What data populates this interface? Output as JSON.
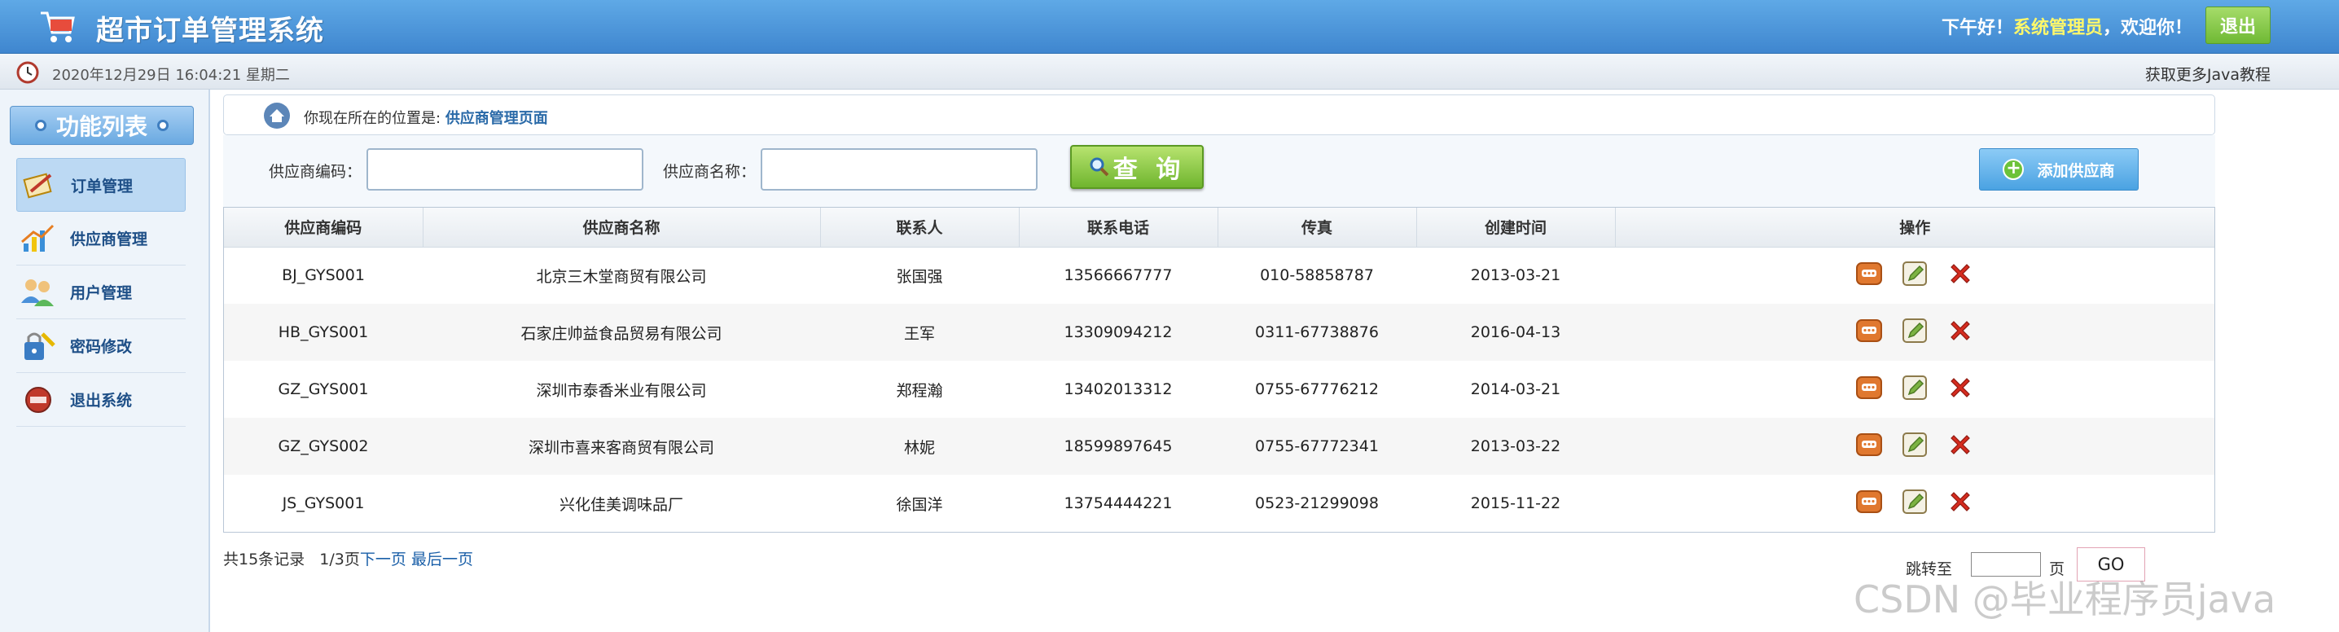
{
  "header": {
    "app_title": "超市订单管理系统",
    "greeting_prefix": "下午好！",
    "admin_name": "系统管理员",
    "greeting_suffix": "，欢迎你！",
    "logout_label": "退出"
  },
  "subbar": {
    "datetime": "2020年12月29日 16:04:21 星期二",
    "more_link": "获取更多Java教程"
  },
  "sidebar": {
    "title": "功能列表",
    "items": [
      {
        "label": "订单管理",
        "icon": "order-icon"
      },
      {
        "label": "供应商管理",
        "icon": "supplier-icon"
      },
      {
        "label": "用户管理",
        "icon": "users-icon"
      },
      {
        "label": "密码修改",
        "icon": "password-icon"
      },
      {
        "label": "退出系统",
        "icon": "exit-icon"
      }
    ]
  },
  "location": {
    "prefix": "你现在所在的位置是:",
    "page": "供应商管理页面"
  },
  "search": {
    "code_label": "供应商编码：",
    "code_value": "",
    "name_label": "供应商名称：",
    "name_value": "",
    "query_label": "查 询",
    "add_label": "添加供应商"
  },
  "table": {
    "headers": [
      "供应商编码",
      "供应商名称",
      "联系人",
      "联系电话",
      "传真",
      "创建时间",
      "操作"
    ],
    "rows": [
      [
        "BJ_GYS001",
        "北京三木堂商贸有限公司",
        "张国强",
        "13566667777",
        "010-58858787",
        "2013-03-21"
      ],
      [
        "HB_GYS001",
        "石家庄帅益食品贸易有限公司",
        "王军",
        "13309094212",
        "0311-67738876",
        "2016-04-13"
      ],
      [
        "GZ_GYS001",
        "深圳市泰香米业有限公司",
        "郑程瀚",
        "13402013312",
        "0755-67776212",
        "2014-03-21"
      ],
      [
        "GZ_GYS002",
        "深圳市喜来客商贸有限公司",
        "林妮",
        "18599897645",
        "0755-67772341",
        "2013-03-22"
      ],
      [
        "JS_GYS001",
        "兴化佳美调味品厂",
        "徐国洋",
        "13754444221",
        "0523-21299098",
        "2015-11-22"
      ]
    ]
  },
  "pager": {
    "summary": "共15条记录   1/3页",
    "next": "下一页",
    "last": "最后一页",
    "jump_label": "跳转至",
    "jump_value": "",
    "page_suffix": "页",
    "go_label": "GO"
  },
  "watermark": "CSDN @毕业程序员java",
  "colors": {
    "header_blue": "#4a93d8",
    "admin_yellow": "#fff86a",
    "green_button": "#7bbf3a",
    "link_blue": "#1a5fa8"
  }
}
